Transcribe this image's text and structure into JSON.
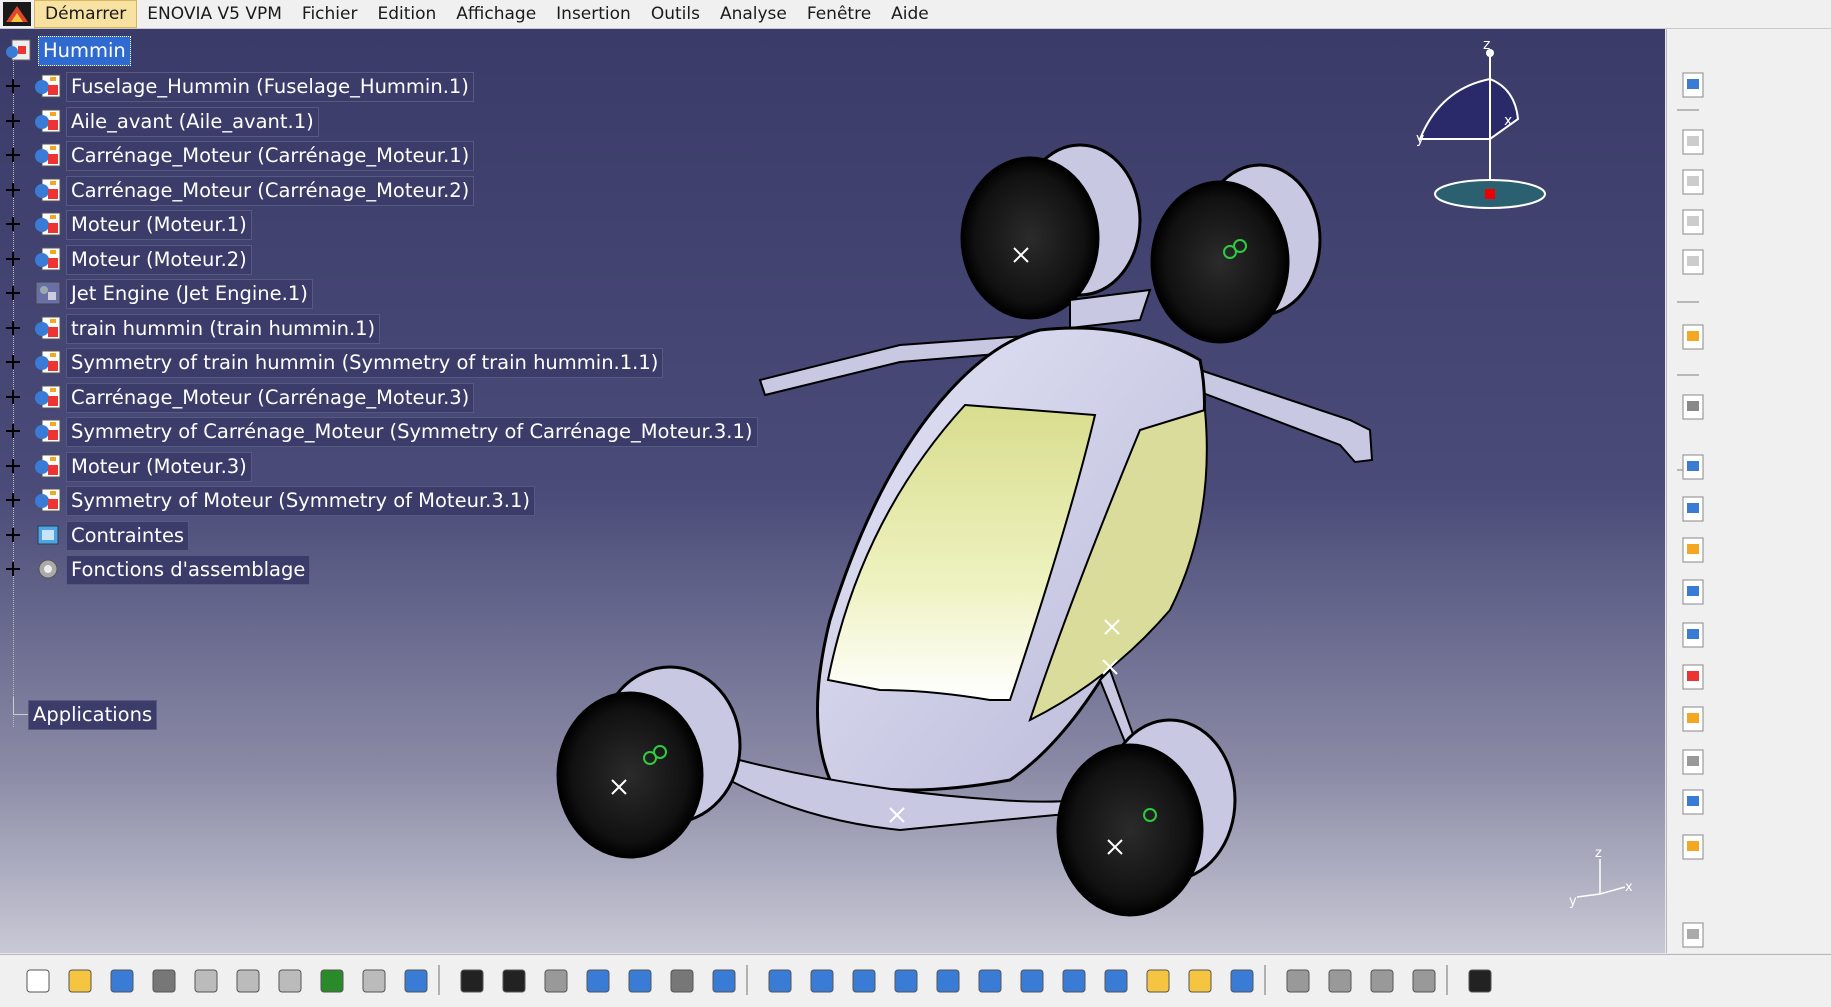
{
  "menu": {
    "items": [
      "Démarrer",
      "ENOVIA V5 VPM",
      "Fichier",
      "Edition",
      "Affichage",
      "Insertion",
      "Outils",
      "Analyse",
      "Fenêtre",
      "Aide"
    ]
  },
  "tree": {
    "root": "Hummin",
    "nodes": [
      {
        "label": "Fuselage_Hummin (Fuselage_Hummin.1)",
        "icon": "product-icon"
      },
      {
        "label": "Aile_avant (Aile_avant.1)",
        "icon": "product-icon"
      },
      {
        "label": "Carrénage_Moteur (Carrénage_Moteur.1)",
        "icon": "product-icon"
      },
      {
        "label": "Carrénage_Moteur (Carrénage_Moteur.2)",
        "icon": "product-icon"
      },
      {
        "label": "Moteur (Moteur.1)",
        "icon": "product-icon"
      },
      {
        "label": "Moteur (Moteur.2)",
        "icon": "product-icon"
      },
      {
        "label": "Jet Engine (Jet Engine.1)",
        "icon": "part-icon"
      },
      {
        "label": "train hummin (train hummin.1)",
        "icon": "product-icon"
      },
      {
        "label": "Symmetry of train hummin (Symmetry of train hummin.1.1)",
        "icon": "product-icon"
      },
      {
        "label": "Carrénage_Moteur (Carrénage_Moteur.3)",
        "icon": "product-icon"
      },
      {
        "label": "Symmetry of Carrénage_Moteur (Symmetry of Carrénage_Moteur.3.1)",
        "icon": "product-icon"
      },
      {
        "label": "Moteur (Moteur.3)",
        "icon": "product-icon"
      },
      {
        "label": "Symmetry of Moteur (Symmetry of Moteur.3.1)",
        "icon": "product-icon"
      },
      {
        "label": "Contraintes",
        "icon": "constraints-icon"
      },
      {
        "label": "Fonctions d'assemblage",
        "icon": "assembly-features-icon"
      }
    ],
    "applications": "Applications"
  },
  "compass": {
    "z": "z",
    "x": "x",
    "y": "y"
  },
  "axis_triad": {
    "z": "z",
    "x": "x",
    "y": "y"
  },
  "right_toolbar": [
    "catalog-icon",
    "product-icon",
    "component-icon",
    "existing-component-icon",
    "part-icon",
    "select-arrow-icon",
    "manipulation-icon",
    "fix-icon",
    "fix-together-icon",
    "constraint-icon",
    "replace-icon",
    "explode-icon",
    "reorder-icon",
    "graph-tree-icon",
    "numbering-icon",
    "bom-icon",
    "annotation-icon",
    "more-icon"
  ],
  "bottom_toolbar": [
    "new-icon",
    "open-icon",
    "save-icon",
    "print-icon",
    "cut-icon",
    "copy-icon",
    "paste-icon",
    "undo-icon",
    "redo-icon",
    "help-icon",
    "formula-icon",
    "comment-icon",
    "link-icon",
    "table-icon",
    "graph-icon",
    "lock-icon",
    "macro-icon",
    "fly-mode-icon",
    "fit-all-icon",
    "pan-icon",
    "rotate-icon",
    "zoom-in-icon",
    "zoom-out-icon",
    "normal-view-icon",
    "multi-view-icon",
    "iso-view-icon",
    "shading-icon",
    "hide-show-icon",
    "swap-visible-icon",
    "disable-icon",
    "skip-icon",
    "analysis-icon",
    "sectioning-icon",
    "capture-icon"
  ],
  "colors": {
    "background_top": "#3a3b68",
    "background_bottom": "#c9c9d6",
    "menu_active": "#f7e2a2",
    "canopy": "#e8ecb0",
    "body": "#d6d6ee"
  }
}
